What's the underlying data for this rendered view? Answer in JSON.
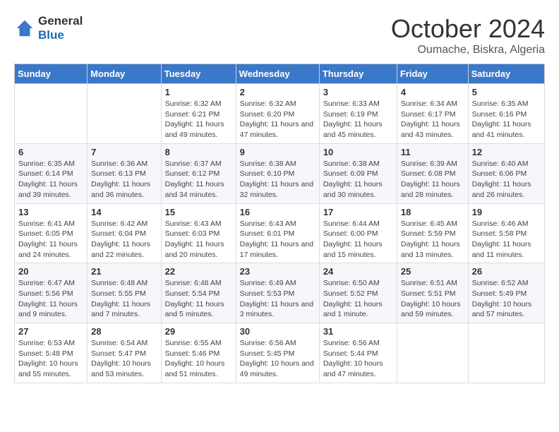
{
  "logo": {
    "general": "General",
    "blue": "Blue"
  },
  "title": "October 2024",
  "location": "Oumache, Biskra, Algeria",
  "weekdays": [
    "Sunday",
    "Monday",
    "Tuesday",
    "Wednesday",
    "Thursday",
    "Friday",
    "Saturday"
  ],
  "weeks": [
    [
      {
        "day": "",
        "info": ""
      },
      {
        "day": "",
        "info": ""
      },
      {
        "day": "1",
        "info": "Sunrise: 6:32 AM\nSunset: 6:21 PM\nDaylight: 11 hours and 49 minutes."
      },
      {
        "day": "2",
        "info": "Sunrise: 6:32 AM\nSunset: 6:20 PM\nDaylight: 11 hours and 47 minutes."
      },
      {
        "day": "3",
        "info": "Sunrise: 6:33 AM\nSunset: 6:19 PM\nDaylight: 11 hours and 45 minutes."
      },
      {
        "day": "4",
        "info": "Sunrise: 6:34 AM\nSunset: 6:17 PM\nDaylight: 11 hours and 43 minutes."
      },
      {
        "day": "5",
        "info": "Sunrise: 6:35 AM\nSunset: 6:16 PM\nDaylight: 11 hours and 41 minutes."
      }
    ],
    [
      {
        "day": "6",
        "info": "Sunrise: 6:35 AM\nSunset: 6:14 PM\nDaylight: 11 hours and 39 minutes."
      },
      {
        "day": "7",
        "info": "Sunrise: 6:36 AM\nSunset: 6:13 PM\nDaylight: 11 hours and 36 minutes."
      },
      {
        "day": "8",
        "info": "Sunrise: 6:37 AM\nSunset: 6:12 PM\nDaylight: 11 hours and 34 minutes."
      },
      {
        "day": "9",
        "info": "Sunrise: 6:38 AM\nSunset: 6:10 PM\nDaylight: 11 hours and 32 minutes."
      },
      {
        "day": "10",
        "info": "Sunrise: 6:38 AM\nSunset: 6:09 PM\nDaylight: 11 hours and 30 minutes."
      },
      {
        "day": "11",
        "info": "Sunrise: 6:39 AM\nSunset: 6:08 PM\nDaylight: 11 hours and 28 minutes."
      },
      {
        "day": "12",
        "info": "Sunrise: 6:40 AM\nSunset: 6:06 PM\nDaylight: 11 hours and 26 minutes."
      }
    ],
    [
      {
        "day": "13",
        "info": "Sunrise: 6:41 AM\nSunset: 6:05 PM\nDaylight: 11 hours and 24 minutes."
      },
      {
        "day": "14",
        "info": "Sunrise: 6:42 AM\nSunset: 6:04 PM\nDaylight: 11 hours and 22 minutes."
      },
      {
        "day": "15",
        "info": "Sunrise: 6:43 AM\nSunset: 6:03 PM\nDaylight: 11 hours and 20 minutes."
      },
      {
        "day": "16",
        "info": "Sunrise: 6:43 AM\nSunset: 6:01 PM\nDaylight: 11 hours and 17 minutes."
      },
      {
        "day": "17",
        "info": "Sunrise: 6:44 AM\nSunset: 6:00 PM\nDaylight: 11 hours and 15 minutes."
      },
      {
        "day": "18",
        "info": "Sunrise: 6:45 AM\nSunset: 5:59 PM\nDaylight: 11 hours and 13 minutes."
      },
      {
        "day": "19",
        "info": "Sunrise: 6:46 AM\nSunset: 5:58 PM\nDaylight: 11 hours and 11 minutes."
      }
    ],
    [
      {
        "day": "20",
        "info": "Sunrise: 6:47 AM\nSunset: 5:56 PM\nDaylight: 11 hours and 9 minutes."
      },
      {
        "day": "21",
        "info": "Sunrise: 6:48 AM\nSunset: 5:55 PM\nDaylight: 11 hours and 7 minutes."
      },
      {
        "day": "22",
        "info": "Sunrise: 6:48 AM\nSunset: 5:54 PM\nDaylight: 11 hours and 5 minutes."
      },
      {
        "day": "23",
        "info": "Sunrise: 6:49 AM\nSunset: 5:53 PM\nDaylight: 11 hours and 3 minutes."
      },
      {
        "day": "24",
        "info": "Sunrise: 6:50 AM\nSunset: 5:52 PM\nDaylight: 11 hours and 1 minute."
      },
      {
        "day": "25",
        "info": "Sunrise: 6:51 AM\nSunset: 5:51 PM\nDaylight: 10 hours and 59 minutes."
      },
      {
        "day": "26",
        "info": "Sunrise: 6:52 AM\nSunset: 5:49 PM\nDaylight: 10 hours and 57 minutes."
      }
    ],
    [
      {
        "day": "27",
        "info": "Sunrise: 6:53 AM\nSunset: 5:48 PM\nDaylight: 10 hours and 55 minutes."
      },
      {
        "day": "28",
        "info": "Sunrise: 6:54 AM\nSunset: 5:47 PM\nDaylight: 10 hours and 53 minutes."
      },
      {
        "day": "29",
        "info": "Sunrise: 6:55 AM\nSunset: 5:46 PM\nDaylight: 10 hours and 51 minutes."
      },
      {
        "day": "30",
        "info": "Sunrise: 6:56 AM\nSunset: 5:45 PM\nDaylight: 10 hours and 49 minutes."
      },
      {
        "day": "31",
        "info": "Sunrise: 6:56 AM\nSunset: 5:44 PM\nDaylight: 10 hours and 47 minutes."
      },
      {
        "day": "",
        "info": ""
      },
      {
        "day": "",
        "info": ""
      }
    ]
  ]
}
